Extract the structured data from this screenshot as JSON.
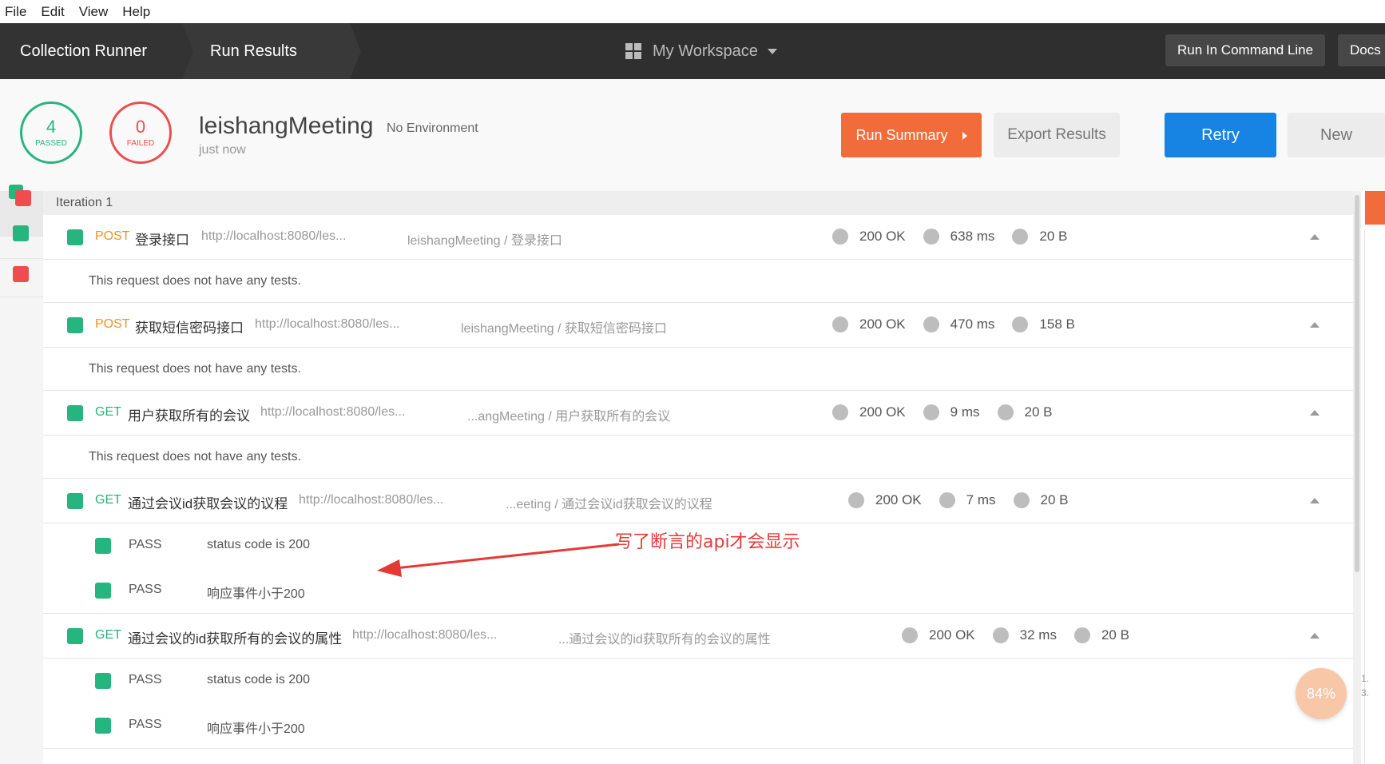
{
  "menu": [
    "File",
    "Edit",
    "View",
    "Help"
  ],
  "header": {
    "crumbs": [
      "Collection Runner",
      "Run Results"
    ],
    "workspace": "My Workspace",
    "run_cmd": "Run In Command Line",
    "docs": "Docs"
  },
  "summary": {
    "passed_count": "4",
    "passed_label": "PASSED",
    "failed_count": "0",
    "failed_label": "FAILED",
    "collection": "leishangMeeting",
    "environment": "No Environment",
    "time": "just now",
    "buttons": {
      "run_summary": "Run Summary",
      "export": "Export Results",
      "retry": "Retry",
      "new": "New"
    }
  },
  "iteration": "Iteration 1",
  "requests": [
    {
      "method": "POST",
      "name": "登录接口",
      "url": "http://localhost:8080/les...",
      "path": "leishangMeeting / 登录接口",
      "status": "200 OK",
      "time": "638 ms",
      "size": "20 B",
      "note": "This request does not have any tests."
    },
    {
      "method": "POST",
      "name": "获取短信密码接口",
      "url": "http://localhost:8080/les...",
      "path": "leishangMeeting / 获取短信密码接口",
      "status": "200 OK",
      "time": "470 ms",
      "size": "158 B",
      "note": "This request does not have any tests."
    },
    {
      "method": "GET",
      "name": "用户获取所有的会议",
      "url": "http://localhost:8080/les...",
      "path": "...angMeeting / 用户获取所有的会议",
      "status": "200 OK",
      "time": "9 ms",
      "size": "20 B",
      "note": "This request does not have any tests."
    },
    {
      "method": "GET",
      "name": "通过会议id获取会议的议程",
      "url": "http://localhost:8080/les...",
      "path": "...eeting / 通过会议id获取会议的议程",
      "status": "200 OK",
      "time": "7 ms",
      "size": "20 B",
      "tests": [
        {
          "result": "PASS",
          "name": "status code is 200"
        },
        {
          "result": "PASS",
          "name": "响应事件小于200"
        }
      ]
    },
    {
      "method": "GET",
      "name": "通过会议的id获取所有的会议的属性",
      "url": "http://localhost:8080/les...",
      "path": "...通过会议的id获取所有的会议的属性",
      "status": "200 OK",
      "time": "32 ms",
      "size": "20 B",
      "tests": [
        {
          "result": "PASS",
          "name": "status code is 200"
        },
        {
          "result": "PASS",
          "name": "响应事件小于200"
        }
      ]
    }
  ],
  "annotation": "写了断言的api才会显示",
  "badge": "84%",
  "mini_numbers": [
    "1.",
    "3."
  ],
  "colors": {
    "pass": "#26b47f",
    "fail": "#ef4d4d",
    "post": "#f29221",
    "accent_orange": "#f26b3a",
    "retry_blue": "#1783e3",
    "annotation_red": "#e53935"
  }
}
